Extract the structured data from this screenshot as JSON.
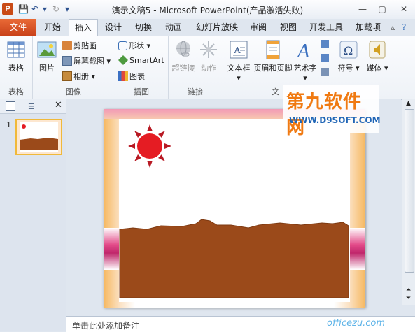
{
  "app": {
    "logo": "P",
    "title": "演示文稿5 - Microsoft PowerPoint(产品激活失败)",
    "window_controls": [
      "—",
      "▢",
      "✕"
    ]
  },
  "tabs": [
    {
      "label": "文件"
    },
    {
      "label": "开始"
    },
    {
      "label": "插入",
      "active": true
    },
    {
      "label": "设计"
    },
    {
      "label": "切换"
    },
    {
      "label": "动画"
    },
    {
      "label": "幻灯片放映"
    },
    {
      "label": "审阅"
    },
    {
      "label": "视图"
    },
    {
      "label": "开发工具"
    },
    {
      "label": "加载项"
    }
  ],
  "ribbon": {
    "groups": {
      "table": {
        "label": "表格",
        "button": "表格"
      },
      "images": {
        "label": "图像",
        "picture": "图片",
        "clipart": "剪贴画",
        "screenshot": "屏幕截图",
        "album": "相册"
      },
      "illustrations": {
        "label": "插图",
        "shapes": "形状",
        "smartart": "SmartArt",
        "chart": "图表"
      },
      "links": {
        "label": "链接",
        "hyperlink": "超链接",
        "action": "动作"
      },
      "text": {
        "label": "文",
        "textbox": "文本框",
        "headerfooter": "页眉和页脚",
        "wordart": "艺术字"
      },
      "symbols": {
        "label": "",
        "symbol": "符号"
      },
      "media": {
        "label": "",
        "media": "媒体"
      }
    }
  },
  "slides_pane": {
    "slide_number": "1"
  },
  "notes": {
    "placeholder": "单击此处添加备注"
  },
  "watermark": {
    "text1": "第九软件网",
    "text2": "WWW.D9SOFT.COM",
    "text3": "officezu.com"
  },
  "colors": {
    "accent": "#c9421a",
    "sun": "#e51c23",
    "ground": "#9b4a1a",
    "band": "#c0266b"
  }
}
